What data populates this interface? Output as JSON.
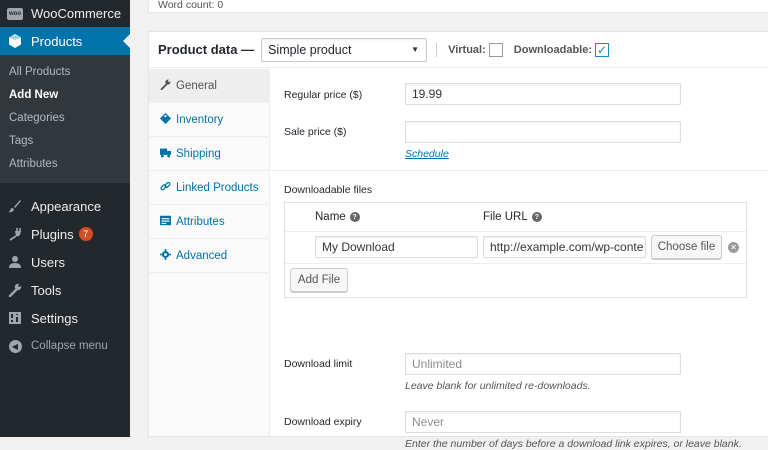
{
  "sidebar": {
    "woocommerce_label": "WooCommerce",
    "woocommerce_logo_text": "woo",
    "products_label": "Products",
    "submenu": [
      "All Products",
      "Add New",
      "Categories",
      "Tags",
      "Attributes"
    ],
    "active_submenu": "Add New",
    "appearance_label": "Appearance",
    "plugins_label": "Plugins",
    "plugins_badge": "7",
    "users_label": "Users",
    "tools_label": "Tools",
    "settings_label": "Settings",
    "collapse_label": "Collapse menu"
  },
  "editor": {
    "word_count": "Word count: 0"
  },
  "product_data": {
    "title": "Product data —",
    "product_type": "Simple product",
    "virtual_label": "Virtual:",
    "virtual_checked": false,
    "downloadable_label": "Downloadable:",
    "downloadable_checked": true,
    "tabs": [
      {
        "label": "General",
        "icon": "wrench-icon"
      },
      {
        "label": "Inventory",
        "icon": "tag-icon"
      },
      {
        "label": "Shipping",
        "icon": "truck-icon"
      },
      {
        "label": "Linked Products",
        "icon": "link-icon"
      },
      {
        "label": "Attributes",
        "icon": "list-icon"
      },
      {
        "label": "Advanced",
        "icon": "gear-icon"
      }
    ],
    "active_tab": "General",
    "regular_price_label": "Regular price ($)",
    "regular_price_value": "19.99",
    "sale_price_label": "Sale price ($)",
    "sale_price_value": "",
    "schedule_link": "Schedule",
    "downloadable_files_label": "Downloadable files",
    "name_col": "Name",
    "file_url_col": "File URL",
    "file_name_value": "My Download",
    "file_url_value": "http://example.com/wp-conte",
    "choose_file_button": "Choose file",
    "add_file_button": "Add File",
    "download_limit_label": "Download limit",
    "download_limit_placeholder": "Unlimited",
    "download_limit_desc": "Leave blank for unlimited re-downloads.",
    "download_expiry_label": "Download expiry",
    "download_expiry_placeholder": "Never",
    "download_expiry_desc": "Enter the number of days before a download link expires, or leave blank."
  },
  "colors": {
    "admin_bar": "#23282d",
    "accent": "#0073aa",
    "badge": "#d54e21"
  }
}
